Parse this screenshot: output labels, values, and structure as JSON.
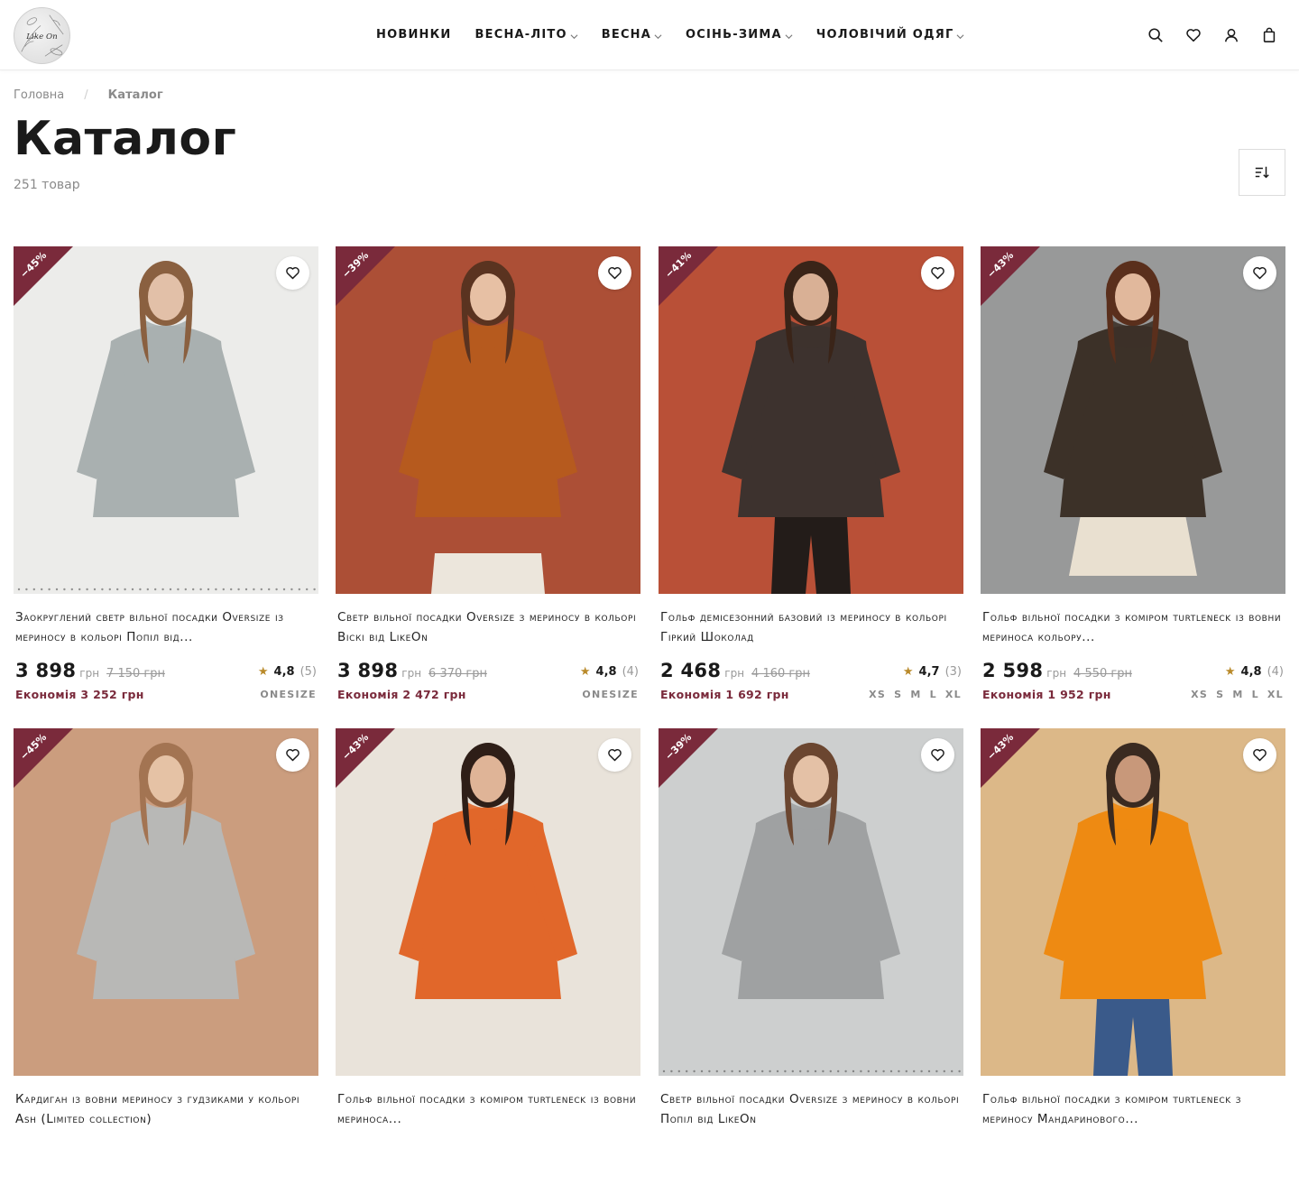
{
  "header": {
    "logo_text": "Like On",
    "nav": [
      {
        "label": "НОВИНКИ",
        "has_dropdown": false
      },
      {
        "label": "ВЕСНА-ЛІТО",
        "has_dropdown": true
      },
      {
        "label": "ВЕСНА",
        "has_dropdown": true
      },
      {
        "label": "ОСІНЬ-ЗИМА",
        "has_dropdown": true
      },
      {
        "label": "ЧОЛОВІЧИЙ ОДЯГ",
        "has_dropdown": true
      }
    ],
    "icons": [
      "search-icon",
      "heart-icon",
      "user-icon",
      "bag-icon"
    ]
  },
  "breadcrumb": {
    "home": "Головна",
    "separator": "/",
    "current": "Каталог"
  },
  "page": {
    "title": "Каталог",
    "count": "251 товар"
  },
  "colors": {
    "accent": "#7a2a3b",
    "star": "#b98a2a"
  },
  "products": [
    {
      "badge": "−45%",
      "title": "Заокруглений светр вільної посадки Oversize із мериносу в кольорі Попіл від...",
      "price": "3 898",
      "currency": "грн",
      "old_price": "7 150 грн",
      "rating": "4,8",
      "reviews": "(5)",
      "saving": "Економія 3 252 грн",
      "sizes": [
        "ONESIZE"
      ]
    },
    {
      "badge": "−39%",
      "title": "Светр вільної посадки Oversize з мериносу в кольорі Віскі від LikeOn",
      "price": "3 898",
      "currency": "грн",
      "old_price": "6 370 грн",
      "rating": "4,8",
      "reviews": "(4)",
      "saving": "Економія 2 472 грн",
      "sizes": [
        "ONESIZE"
      ]
    },
    {
      "badge": "−41%",
      "title": "Гольф демісезонний базовий із мериносу в кольорі Гіркий Шоколад",
      "price": "2 468",
      "currency": "грн",
      "old_price": "4 160 грн",
      "rating": "4,7",
      "reviews": "(3)",
      "saving": "Економія 1 692 грн",
      "sizes": [
        "XS",
        "S",
        "M",
        "L",
        "XL"
      ]
    },
    {
      "badge": "−43%",
      "title": "Гольф вільної посадки з коміром turtleneck із вовни мериноса кольору...",
      "price": "2 598",
      "currency": "грн",
      "old_price": "4 550 грн",
      "rating": "4,8",
      "reviews": "(4)",
      "saving": "Економія 1 952 грн",
      "sizes": [
        "XS",
        "S",
        "M",
        "L",
        "XL"
      ]
    },
    {
      "badge": "−45%",
      "title": "Кардиган із вовни мериносу з гудзиками у кольорі Ash (Limited collection)",
      "price": "",
      "currency": "",
      "old_price": "",
      "rating": "",
      "reviews": "",
      "saving": "",
      "sizes": []
    },
    {
      "badge": "−43%",
      "title": "Гольф вільної посадки з коміром turtleneck із вовни мериноса...",
      "price": "",
      "currency": "",
      "old_price": "",
      "rating": "",
      "reviews": "",
      "saving": "",
      "sizes": []
    },
    {
      "badge": "−39%",
      "title": "Светр вільної посадки Oversize з мериносу в кольорі Попіл від LikeOn",
      "price": "",
      "currency": "",
      "old_price": "",
      "rating": "",
      "reviews": "",
      "saving": "",
      "sizes": []
    },
    {
      "badge": "−43%",
      "title": "Гольф вільної посадки з коміром turtleneck з мериносу Мандаринового...",
      "price": "",
      "currency": "",
      "old_price": "",
      "rating": "",
      "reviews": "",
      "saving": "",
      "sizes": []
    }
  ]
}
